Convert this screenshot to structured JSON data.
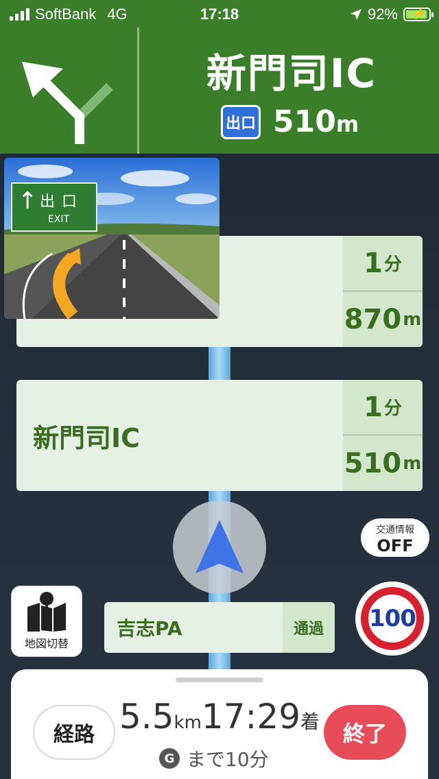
{
  "status": {
    "carrier": "SoftBank",
    "network": "4G",
    "time": "17:18",
    "battery": "92%"
  },
  "guide": {
    "name": "新門司IC",
    "exit_badge": "出口",
    "distance": "510",
    "distance_unit": "m"
  },
  "junction": {
    "sign_text": "出口",
    "sign_sub": "EXIT"
  },
  "cards": [
    {
      "name": "",
      "time": "1",
      "time_unit": "分",
      "dist": "870",
      "dist_unit": "m"
    },
    {
      "name": "新門司IC",
      "time": "1",
      "time_unit": "分",
      "dist": "510",
      "dist_unit": "m"
    }
  ],
  "traffic": {
    "label": "交通情報",
    "state": "OFF"
  },
  "mapswitch": {
    "label": "地図切替"
  },
  "pa": {
    "name": "吉志PA",
    "status": "通過"
  },
  "speed_limit": "100",
  "panel": {
    "route_label": "経路",
    "distance": "5.5",
    "distance_unit": "km",
    "arrival": "17:29",
    "arrival_suffix": "着",
    "until": "まで10分",
    "g_icon": "G",
    "end_label": "終了"
  },
  "colors": {
    "header_green": "#3a7e2a",
    "card_bg": "#e6f1e6",
    "text_green": "#3b6d21",
    "end_red": "#e84c58",
    "route_blue": "#a9dcfa"
  }
}
